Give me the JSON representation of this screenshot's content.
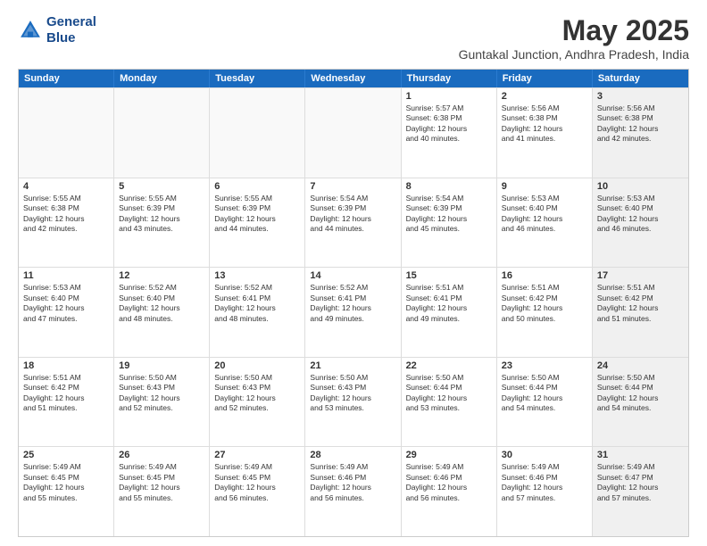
{
  "logo": {
    "line1": "General",
    "line2": "Blue"
  },
  "title": "May 2025",
  "subtitle": "Guntakal Junction, Andhra Pradesh, India",
  "header_days": [
    "Sunday",
    "Monday",
    "Tuesday",
    "Wednesday",
    "Thursday",
    "Friday",
    "Saturday"
  ],
  "rows": [
    [
      {
        "day": "",
        "lines": [],
        "empty": true
      },
      {
        "day": "",
        "lines": [],
        "empty": true
      },
      {
        "day": "",
        "lines": [],
        "empty": true
      },
      {
        "day": "",
        "lines": [],
        "empty": true
      },
      {
        "day": "1",
        "lines": [
          "Sunrise: 5:57 AM",
          "Sunset: 6:38 PM",
          "Daylight: 12 hours",
          "and 40 minutes."
        ]
      },
      {
        "day": "2",
        "lines": [
          "Sunrise: 5:56 AM",
          "Sunset: 6:38 PM",
          "Daylight: 12 hours",
          "and 41 minutes."
        ]
      },
      {
        "day": "3",
        "lines": [
          "Sunrise: 5:56 AM",
          "Sunset: 6:38 PM",
          "Daylight: 12 hours",
          "and 42 minutes."
        ],
        "shaded": true
      }
    ],
    [
      {
        "day": "4",
        "lines": [
          "Sunrise: 5:55 AM",
          "Sunset: 6:38 PM",
          "Daylight: 12 hours",
          "and 42 minutes."
        ]
      },
      {
        "day": "5",
        "lines": [
          "Sunrise: 5:55 AM",
          "Sunset: 6:39 PM",
          "Daylight: 12 hours",
          "and 43 minutes."
        ]
      },
      {
        "day": "6",
        "lines": [
          "Sunrise: 5:55 AM",
          "Sunset: 6:39 PM",
          "Daylight: 12 hours",
          "and 44 minutes."
        ]
      },
      {
        "day": "7",
        "lines": [
          "Sunrise: 5:54 AM",
          "Sunset: 6:39 PM",
          "Daylight: 12 hours",
          "and 44 minutes."
        ]
      },
      {
        "day": "8",
        "lines": [
          "Sunrise: 5:54 AM",
          "Sunset: 6:39 PM",
          "Daylight: 12 hours",
          "and 45 minutes."
        ]
      },
      {
        "day": "9",
        "lines": [
          "Sunrise: 5:53 AM",
          "Sunset: 6:40 PM",
          "Daylight: 12 hours",
          "and 46 minutes."
        ]
      },
      {
        "day": "10",
        "lines": [
          "Sunrise: 5:53 AM",
          "Sunset: 6:40 PM",
          "Daylight: 12 hours",
          "and 46 minutes."
        ],
        "shaded": true
      }
    ],
    [
      {
        "day": "11",
        "lines": [
          "Sunrise: 5:53 AM",
          "Sunset: 6:40 PM",
          "Daylight: 12 hours",
          "and 47 minutes."
        ]
      },
      {
        "day": "12",
        "lines": [
          "Sunrise: 5:52 AM",
          "Sunset: 6:40 PM",
          "Daylight: 12 hours",
          "and 48 minutes."
        ]
      },
      {
        "day": "13",
        "lines": [
          "Sunrise: 5:52 AM",
          "Sunset: 6:41 PM",
          "Daylight: 12 hours",
          "and 48 minutes."
        ]
      },
      {
        "day": "14",
        "lines": [
          "Sunrise: 5:52 AM",
          "Sunset: 6:41 PM",
          "Daylight: 12 hours",
          "and 49 minutes."
        ]
      },
      {
        "day": "15",
        "lines": [
          "Sunrise: 5:51 AM",
          "Sunset: 6:41 PM",
          "Daylight: 12 hours",
          "and 49 minutes."
        ]
      },
      {
        "day": "16",
        "lines": [
          "Sunrise: 5:51 AM",
          "Sunset: 6:42 PM",
          "Daylight: 12 hours",
          "and 50 minutes."
        ]
      },
      {
        "day": "17",
        "lines": [
          "Sunrise: 5:51 AM",
          "Sunset: 6:42 PM",
          "Daylight: 12 hours",
          "and 51 minutes."
        ],
        "shaded": true
      }
    ],
    [
      {
        "day": "18",
        "lines": [
          "Sunrise: 5:51 AM",
          "Sunset: 6:42 PM",
          "Daylight: 12 hours",
          "and 51 minutes."
        ]
      },
      {
        "day": "19",
        "lines": [
          "Sunrise: 5:50 AM",
          "Sunset: 6:43 PM",
          "Daylight: 12 hours",
          "and 52 minutes."
        ]
      },
      {
        "day": "20",
        "lines": [
          "Sunrise: 5:50 AM",
          "Sunset: 6:43 PM",
          "Daylight: 12 hours",
          "and 52 minutes."
        ]
      },
      {
        "day": "21",
        "lines": [
          "Sunrise: 5:50 AM",
          "Sunset: 6:43 PM",
          "Daylight: 12 hours",
          "and 53 minutes."
        ]
      },
      {
        "day": "22",
        "lines": [
          "Sunrise: 5:50 AM",
          "Sunset: 6:44 PM",
          "Daylight: 12 hours",
          "and 53 minutes."
        ]
      },
      {
        "day": "23",
        "lines": [
          "Sunrise: 5:50 AM",
          "Sunset: 6:44 PM",
          "Daylight: 12 hours",
          "and 54 minutes."
        ]
      },
      {
        "day": "24",
        "lines": [
          "Sunrise: 5:50 AM",
          "Sunset: 6:44 PM",
          "Daylight: 12 hours",
          "and 54 minutes."
        ],
        "shaded": true
      }
    ],
    [
      {
        "day": "25",
        "lines": [
          "Sunrise: 5:49 AM",
          "Sunset: 6:45 PM",
          "Daylight: 12 hours",
          "and 55 minutes."
        ]
      },
      {
        "day": "26",
        "lines": [
          "Sunrise: 5:49 AM",
          "Sunset: 6:45 PM",
          "Daylight: 12 hours",
          "and 55 minutes."
        ]
      },
      {
        "day": "27",
        "lines": [
          "Sunrise: 5:49 AM",
          "Sunset: 6:45 PM",
          "Daylight: 12 hours",
          "and 56 minutes."
        ]
      },
      {
        "day": "28",
        "lines": [
          "Sunrise: 5:49 AM",
          "Sunset: 6:46 PM",
          "Daylight: 12 hours",
          "and 56 minutes."
        ]
      },
      {
        "day": "29",
        "lines": [
          "Sunrise: 5:49 AM",
          "Sunset: 6:46 PM",
          "Daylight: 12 hours",
          "and 56 minutes."
        ]
      },
      {
        "day": "30",
        "lines": [
          "Sunrise: 5:49 AM",
          "Sunset: 6:46 PM",
          "Daylight: 12 hours",
          "and 57 minutes."
        ]
      },
      {
        "day": "31",
        "lines": [
          "Sunrise: 5:49 AM",
          "Sunset: 6:47 PM",
          "Daylight: 12 hours",
          "and 57 minutes."
        ],
        "shaded": true
      }
    ]
  ]
}
